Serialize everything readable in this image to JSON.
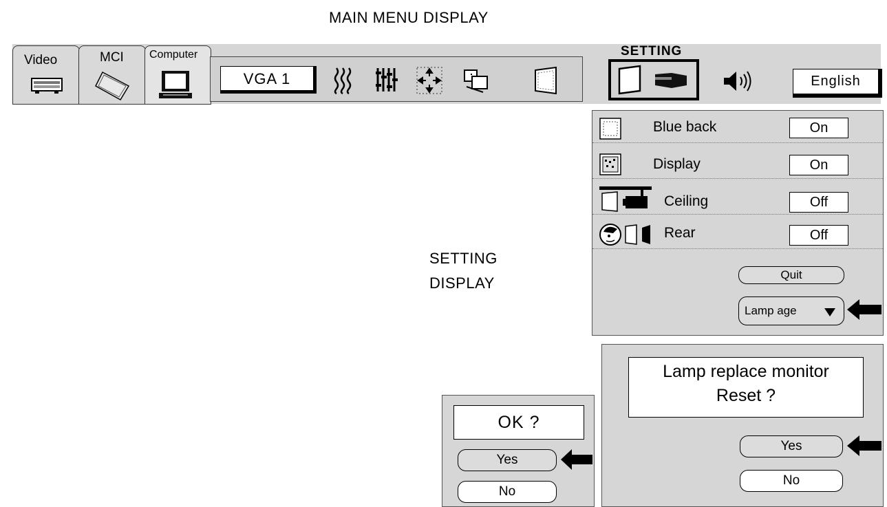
{
  "captions": {
    "main_menu": "MAIN MENU DISPLAY",
    "setting_display_line1": "SETTING",
    "setting_display_line2": "DISPLAY"
  },
  "tabs": {
    "video": "Video",
    "mci": "MCI",
    "computer": "Computer"
  },
  "toolbar": {
    "source_value": "VGA 1"
  },
  "setting_panel": {
    "title": "SETTING",
    "language": "English"
  },
  "setting_menu": {
    "rows": [
      {
        "label": "Blue back",
        "value": "On",
        "icon": "screen-dotted-icon"
      },
      {
        "label": "Display",
        "value": "On",
        "icon": "screen-pattern-icon"
      },
      {
        "label": "Ceiling",
        "value": "Off",
        "icon": "ceiling-projector-icon"
      },
      {
        "label": "Rear",
        "value": "Off",
        "icon": "rear-projection-icon"
      }
    ],
    "quit_label": "Quit",
    "lamp_age_label": "Lamp age"
  },
  "lamp_dialog": {
    "line1": "Lamp replace monitor",
    "line2": "Reset ?",
    "yes_label": "Yes",
    "no_label": "No"
  },
  "ok_dialog": {
    "title": "OK ?",
    "yes_label": "Yes",
    "no_label": "No"
  }
}
